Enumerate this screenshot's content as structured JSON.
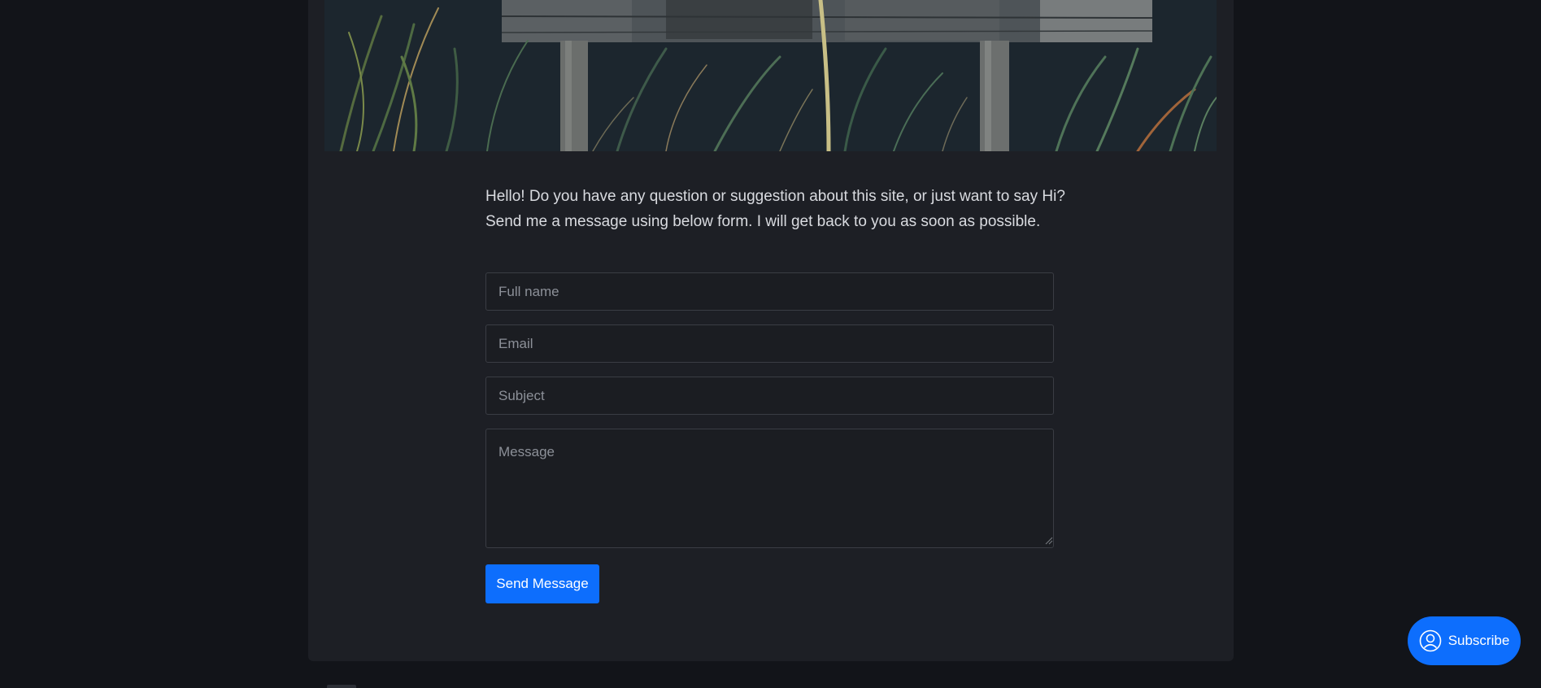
{
  "contact": {
    "intro_line1": "Hello! Do you have any question or suggestion about this site, or just want to say Hi?",
    "intro_line2": "Send me a message using below form. I will get back to you as soon as possible."
  },
  "form": {
    "fullname_placeholder": "Full name",
    "email_placeholder": "Email",
    "subject_placeholder": "Subject",
    "message_placeholder": "Message",
    "send_label": "Send Message"
  },
  "subscribe": {
    "label": "Subscribe",
    "icon": "user-circle-icon"
  },
  "colors": {
    "accent": "#0d6efd",
    "page_bg": "#121419",
    "card_bg": "#1d1f25"
  }
}
